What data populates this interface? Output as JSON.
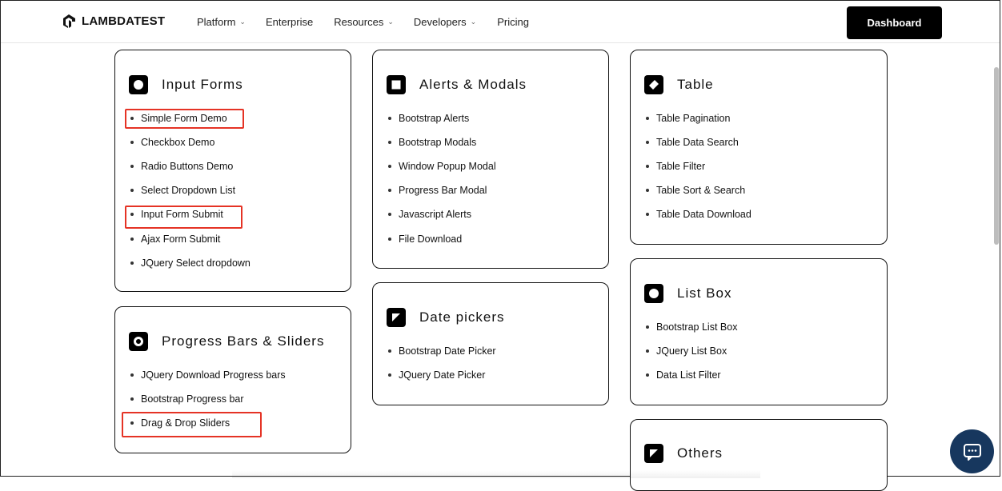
{
  "header": {
    "logo_text": "LAMBDATEST",
    "nav": [
      {
        "label": "Platform",
        "dropdown": true
      },
      {
        "label": "Enterprise",
        "dropdown": false
      },
      {
        "label": "Resources",
        "dropdown": true
      },
      {
        "label": "Developers",
        "dropdown": true
      },
      {
        "label": "Pricing",
        "dropdown": false
      }
    ],
    "dashboard_label": "Dashboard"
  },
  "cards": {
    "input_forms": {
      "title": "Input Forms",
      "icon": "circle-icon",
      "links": [
        "Simple Form Demo",
        "Checkbox Demo",
        "Radio Buttons Demo",
        "Select Dropdown List",
        "Input Form Submit",
        "Ajax Form Submit",
        "JQuery Select dropdown"
      ]
    },
    "progress_bars": {
      "title": "Progress Bars & Sliders",
      "icon": "ring-icon",
      "links": [
        "JQuery Download Progress bars",
        "Bootstrap Progress bar",
        "Drag & Drop Sliders"
      ]
    },
    "alerts_modals": {
      "title": "Alerts & Modals",
      "icon": "square-icon",
      "links": [
        "Bootstrap Alerts",
        "Bootstrap Modals",
        "Window Popup Modal",
        "Progress Bar Modal",
        "Javascript Alerts",
        "File Download"
      ]
    },
    "date_pickers": {
      "title": "Date pickers",
      "icon": "triangle-icon",
      "links": [
        "Bootstrap Date Picker",
        "JQuery Date Picker"
      ]
    },
    "table": {
      "title": "Table",
      "icon": "diamond-icon",
      "links": [
        "Table Pagination",
        "Table Data Search",
        "Table Filter",
        "Table Sort & Search",
        "Table Data Download"
      ]
    },
    "list_box": {
      "title": "List Box",
      "icon": "circle-icon",
      "links": [
        "Bootstrap List Box",
        "JQuery List Box",
        "Data List Filter"
      ]
    },
    "others": {
      "title": "Others",
      "icon": "triangle-icon"
    }
  },
  "highlight_color": "#e53325",
  "chat_color": "#17375e"
}
